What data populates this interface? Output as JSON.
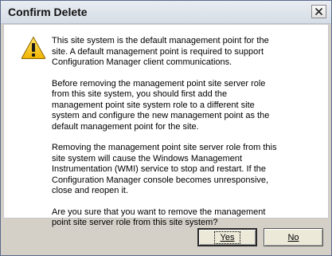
{
  "window": {
    "title": "Confirm Delete",
    "close_glyph": "✕"
  },
  "icons": {
    "warning": "warning-triangle-icon",
    "close": "close-icon"
  },
  "colors": {
    "warning_yellow": "#f5c400",
    "warning_outline": "#7a5a00",
    "client_bg": "#ffffff",
    "frame_bg": "#d4d0c8"
  },
  "message": {
    "p1": "This site system is the default management point for the site. A default management point is required to support Configuration Manager client communications.",
    "p2": "Before removing the management point site server role from this site system, you should first add the management point site system role to a different site system and configure the new management point as the default management point for the site.",
    "p3": "Removing the management point site server role from this site system will cause the Windows Management Instrumentation (WMI) service to stop and restart. If the Configuration Manager console becomes unresponsive, close and reopen it.",
    "p4": "Are you sure that you want to remove the management point site server role from this site system?"
  },
  "buttons": {
    "yes_label": "Yes",
    "no_label": "No"
  }
}
